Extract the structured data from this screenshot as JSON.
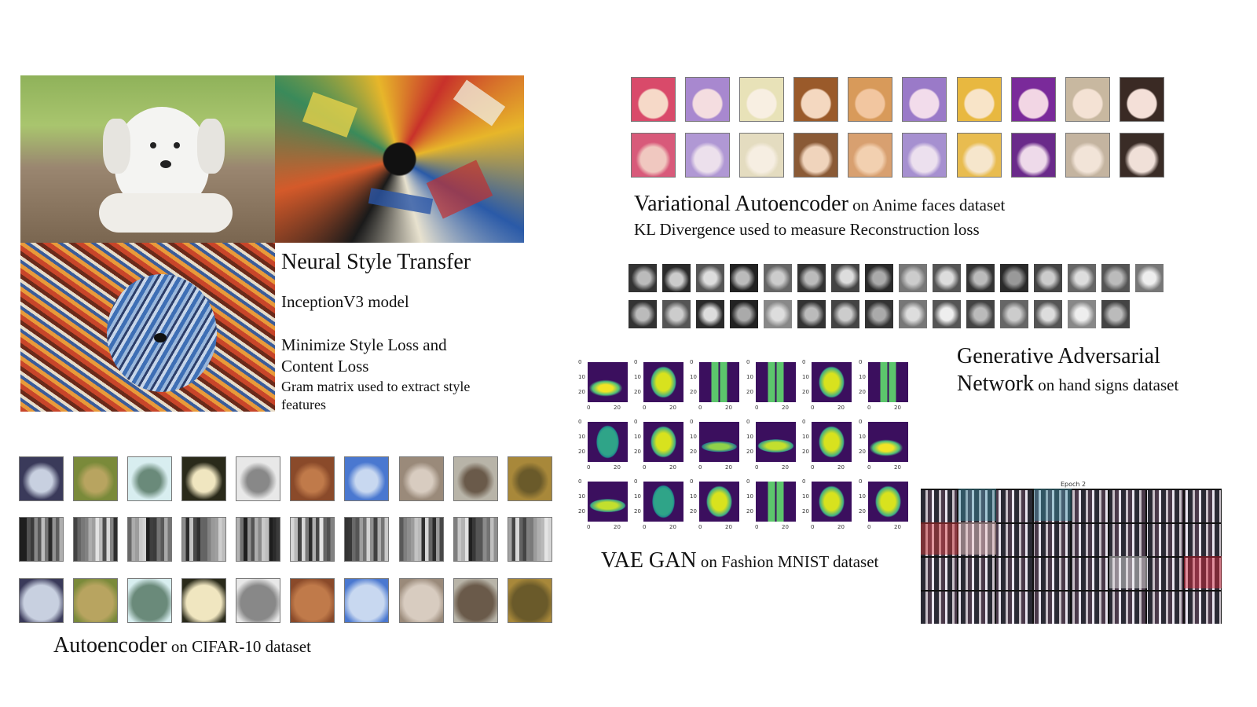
{
  "style_transfer": {
    "title": "Neural Style Transfer",
    "model": "InceptionV3 model",
    "loss_line1": "Minimize Style Loss and",
    "loss_line2": "Content Loss",
    "gram_line1": "Gram matrix used to extract style",
    "gram_line2": "features"
  },
  "vae": {
    "title_big": "Variational Autoencoder",
    "title_small": " on Anime faces dataset",
    "subtitle": "KL Divergence used to measure Reconstruction loss"
  },
  "gan": {
    "title_line1": "Generative Adversarial",
    "title_line2_big": "Network",
    "title_line2_small": " on hand signs dataset",
    "epoch_label": "Epoch 2"
  },
  "vae_gan": {
    "title_big": "VAE GAN",
    "title_small": " on Fashion MNIST dataset",
    "ticks_y": [
      "0",
      "10",
      "20"
    ],
    "ticks_x": [
      "0",
      "20"
    ]
  },
  "autoencoder": {
    "title_big": "Autoencoder",
    "title_small": " on CIFAR-10 dataset"
  }
}
